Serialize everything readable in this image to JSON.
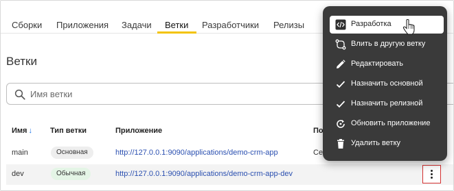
{
  "tabs": [
    {
      "label": "Сборки"
    },
    {
      "label": "Приложения"
    },
    {
      "label": "Задачи"
    },
    {
      "label": "Ветки"
    },
    {
      "label": "Разработчики"
    },
    {
      "label": "Релизы"
    }
  ],
  "active_tab": "Ветки",
  "section_title": "Ветки",
  "search": {
    "placeholder": "Имя ветки",
    "value": "",
    "icon": "search-icon"
  },
  "table": {
    "columns": [
      "Имя",
      "Тип ветки",
      "Приложение",
      "По"
    ],
    "sort_indicator": "↓",
    "rows": [
      {
        "name": "main",
        "type": "Основная",
        "app": "http://127.0.0.1:9090/applications/demo-crm-app",
        "extra": "Се"
      },
      {
        "name": "dev",
        "type": "Обычная",
        "app": "http://127.0.0.1:9090/applications/demo-crm-app-dev",
        "extra": ""
      }
    ]
  },
  "context_menu": {
    "items": [
      {
        "label": "Разработка",
        "icon": "code-icon",
        "active": true
      },
      {
        "label": "Влить в другую ветку",
        "icon": "merge-icon",
        "active": false
      },
      {
        "label": "Редактировать",
        "icon": "pencil-icon",
        "active": false
      },
      {
        "label": "Назначить основной",
        "icon": "check-icon",
        "active": false
      },
      {
        "label": "Назначить релизной",
        "icon": "check-icon",
        "active": false
      },
      {
        "label": "Обновить приложение",
        "icon": "refresh-icon",
        "active": false
      },
      {
        "label": "Удалить ветку",
        "icon": "trash-icon",
        "active": false
      }
    ]
  },
  "colors": {
    "accent_tab": "#f3c300",
    "menu_bg": "#3a3a3a",
    "link": "#2a4fb0",
    "kebab_border": "#d32f2f",
    "chip_normal": "#e4f5e6"
  }
}
